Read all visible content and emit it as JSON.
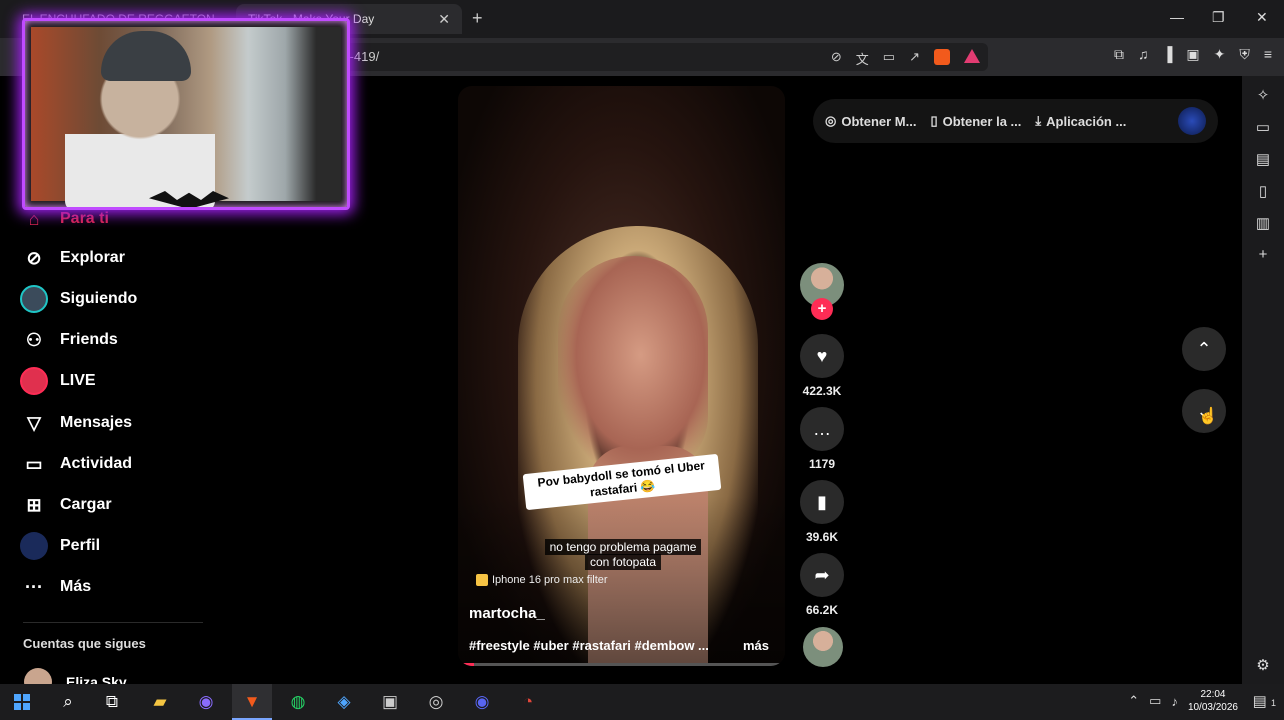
{
  "browser": {
    "tabs": [
      {
        "label": "EL ENCHUFADO DE REGGAETON",
        "active": false
      },
      {
        "label": "TikTok - Make Your Day",
        "active": true
      }
    ],
    "new_tab": "+",
    "url": "/rt-419/",
    "window_controls": {
      "minimize": "—",
      "maximize": "❐",
      "close": "✕"
    }
  },
  "sidebar": {
    "items": [
      {
        "label": "Para ti",
        "icon": "home-icon"
      },
      {
        "label": "Explorar",
        "icon": "compass-icon"
      },
      {
        "label": "Siguiendo",
        "icon": "following-avatar-icon"
      },
      {
        "label": "Friends",
        "icon": "friends-icon"
      },
      {
        "label": "LIVE",
        "icon": "live-icon"
      },
      {
        "label": "Mensajes",
        "icon": "send-icon"
      },
      {
        "label": "Actividad",
        "icon": "activity-icon"
      },
      {
        "label": "Cargar",
        "icon": "upload-icon"
      },
      {
        "label": "Perfil",
        "icon": "profile-avatar-icon"
      },
      {
        "label": "Más",
        "icon": "more-dots-icon"
      }
    ],
    "following_section_title": "Cuentas que sigues",
    "following": [
      {
        "name": "Eliza Sky"
      }
    ]
  },
  "get_bar": {
    "items": [
      {
        "label": "Obtener M...",
        "icon": "coin-icon"
      },
      {
        "label": "Obtener la ...",
        "icon": "phone-icon"
      },
      {
        "label": "Aplicación ...",
        "icon": "download-icon"
      }
    ]
  },
  "video": {
    "caption_overlay": "Pov babydoll se tomó el Uber rastafari 😂",
    "subtitle_line1": "no tengo problema pagame",
    "subtitle_line2": "con fotopata",
    "filter_label": "Iphone 16 pro max filter",
    "username": "martocha_",
    "hashtags": "#freestyle #uber #rastafari #dembow ...",
    "more_label": "más",
    "progress_fraction": 0.05
  },
  "actions": {
    "follow_plus": "+",
    "likes": "422.3K",
    "comments": "1179",
    "saves": "39.6K",
    "shares": "66.2K"
  },
  "taskbar": {
    "time": "22:04",
    "date": "10/03/2026",
    "notification_count": "1"
  },
  "colors": {
    "accent": "#fe2c55",
    "webcam_border": "#c04bff",
    "taskbar_accent": "#7aa6ff"
  }
}
